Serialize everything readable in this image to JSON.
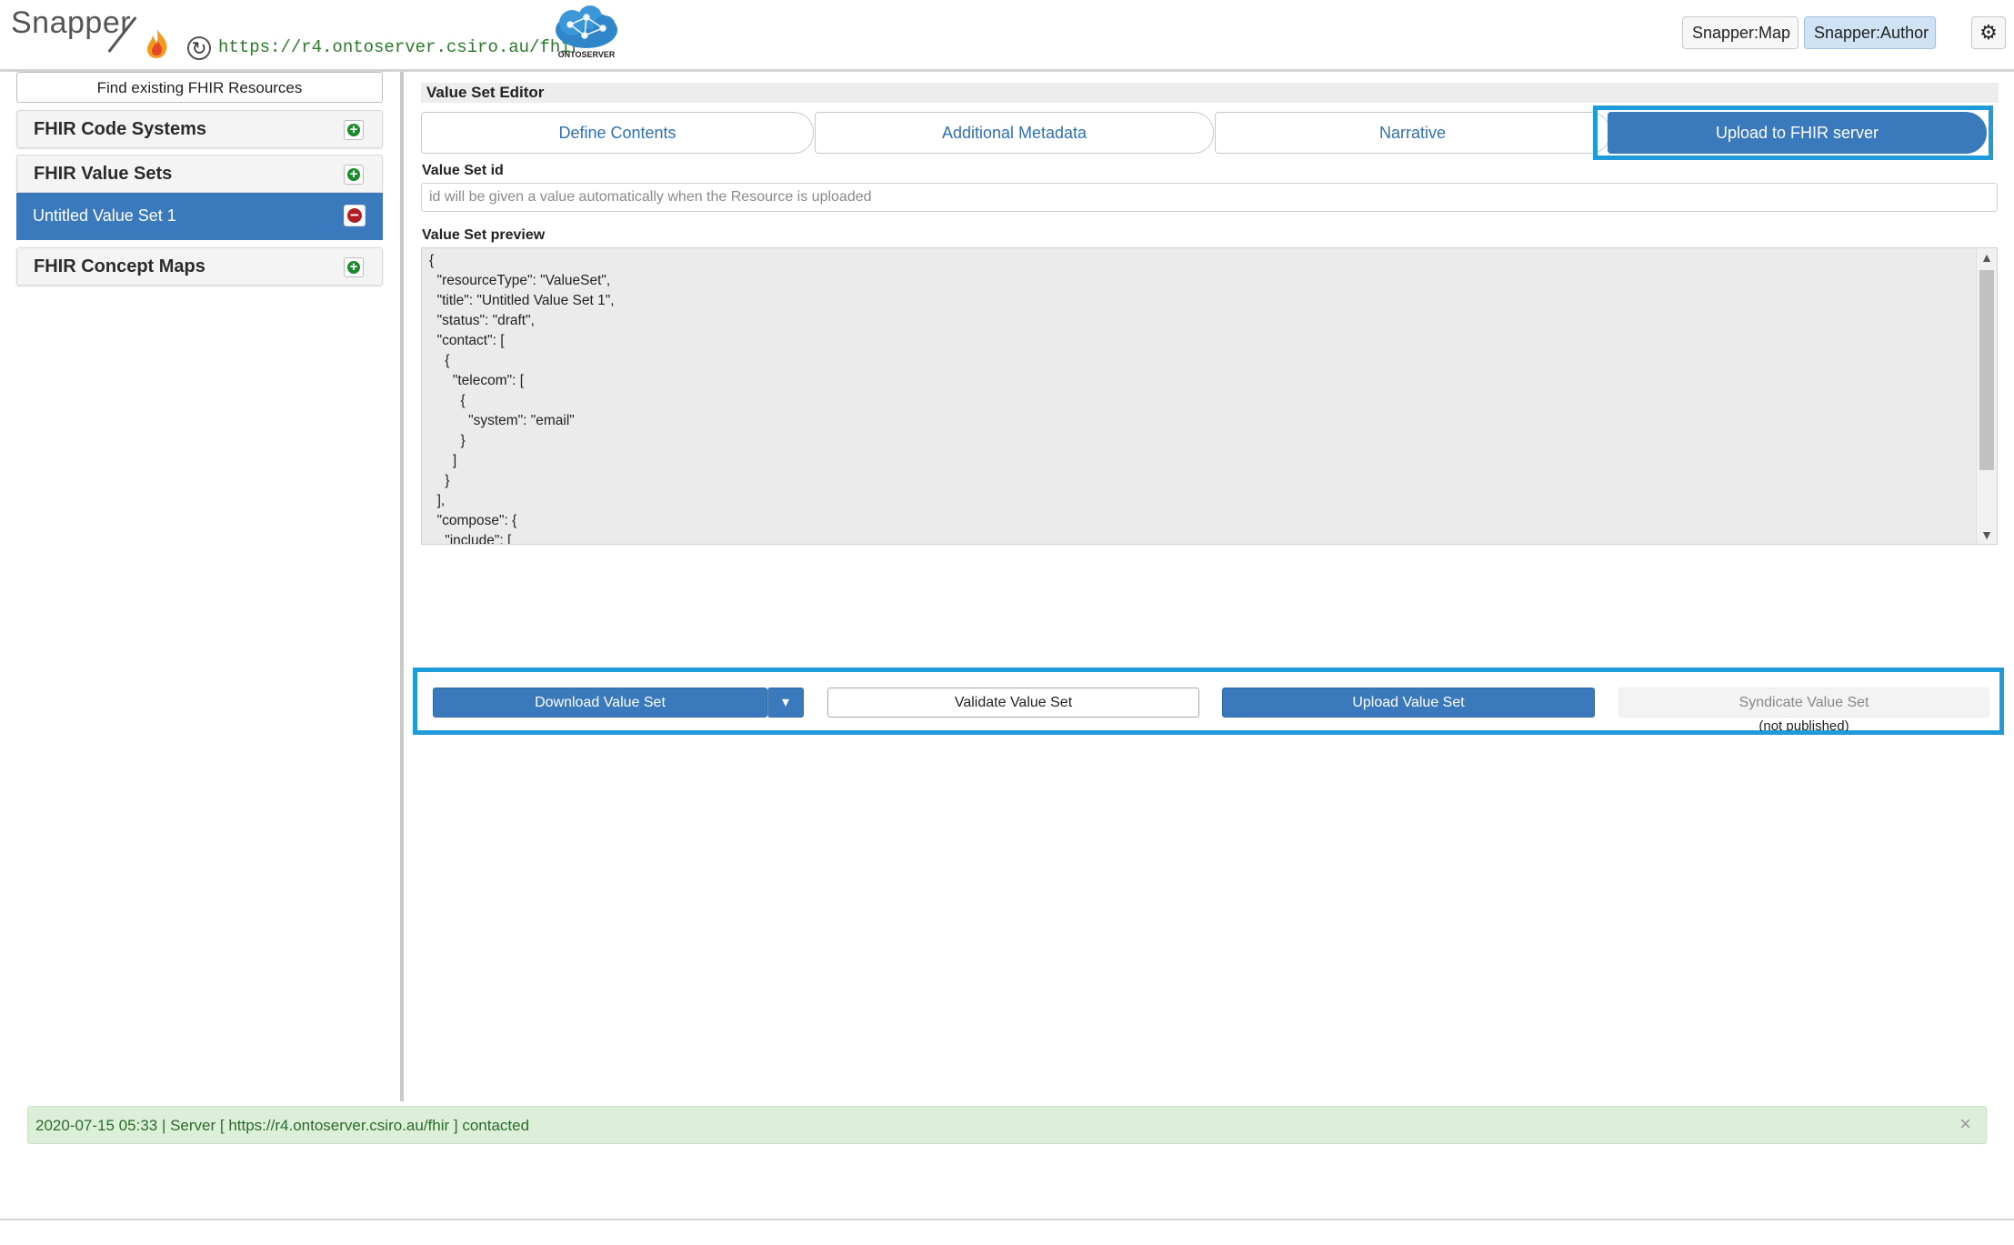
{
  "header": {
    "logo_text": "Snapper",
    "server_url": "https://r4.ontoserver.csiro.au/fhir",
    "ontoserver_label": "ONTOSERVER",
    "buttons": {
      "map": "Snapper:Map",
      "author": "Snapper:Author",
      "settings_icon": "gear-icon"
    }
  },
  "sidebar": {
    "find_button": "Find existing FHIR Resources",
    "sections": [
      {
        "label": "FHIR Code Systems",
        "icon": "plus-circle-icon"
      },
      {
        "label": "FHIR Value Sets",
        "icon": "plus-circle-icon",
        "items": [
          {
            "label": "Untitled Value Set 1",
            "icon": "minus-circle-icon",
            "selected": true
          }
        ]
      },
      {
        "label": "FHIR Concept Maps",
        "icon": "plus-circle-icon"
      }
    ]
  },
  "editor": {
    "title": "Value Set Editor",
    "tabs": [
      "Define Contents",
      "Additional Metadata",
      "Narrative",
      "Upload to FHIR server"
    ],
    "active_tab": "Upload to FHIR server",
    "value_set_id": {
      "label": "Value Set id",
      "value": "",
      "placeholder": "id will be given a value automatically when the Resource is uploaded"
    },
    "preview": {
      "label": "Value Set preview",
      "content": "{\n  \"resourceType\": \"ValueSet\",\n  \"title\": \"Untitled Value Set 1\",\n  \"status\": \"draft\",\n  \"contact\": [\n    {\n      \"telecom\": [\n        {\n          \"system\": \"email\"\n        }\n      ]\n    }\n  ],\n  \"compose\": {\n    \"include\": [\n      {\n        \"system\": \"http://snomed.info/sct\"\n      }\n    ]\n  },\n  \"text\": {"
    },
    "actions": {
      "download": "Download Value Set",
      "validate": "Validate Value Set",
      "upload": "Upload Value Set",
      "syndicate": "Syndicate Value Set",
      "syndicate_note": "(not published)"
    }
  },
  "status": {
    "message": "2020-07-15 05:33 | Server [ https://r4.ontoserver.csiro.au/fhir ] contacted",
    "close_symbol": "×"
  },
  "colors": {
    "primary": "#3a79bb",
    "highlight": "#1f9bd9",
    "status_bg": "#dcefd8",
    "url_green": "#2a7a2a"
  }
}
